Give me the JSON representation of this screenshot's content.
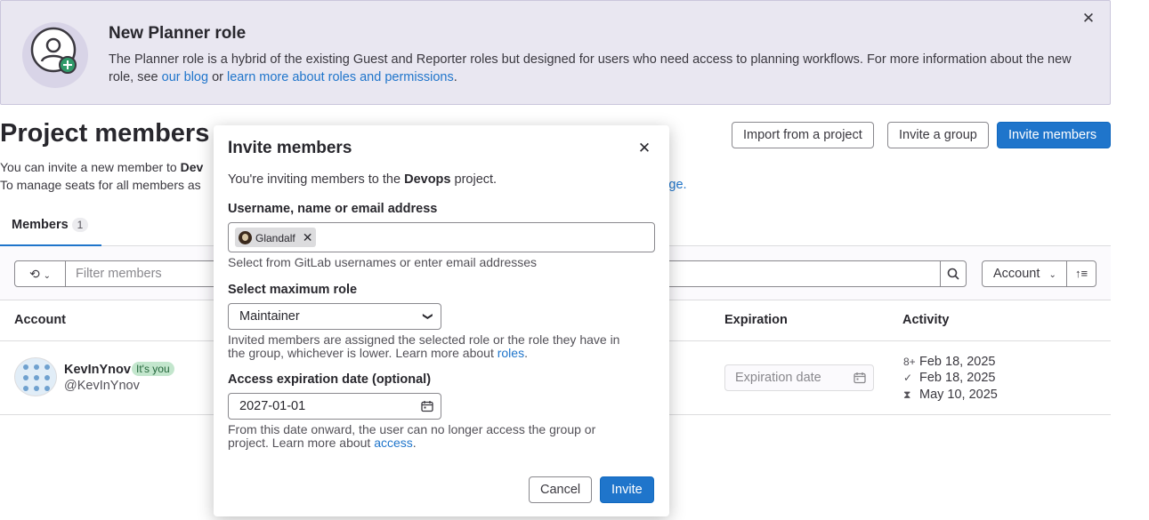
{
  "banner": {
    "title": "New Planner role",
    "body_text": "The Planner role is a hybrid of the existing Guest and Reporter roles but designed for users who need access to planning workflows. For more information about the new role, see ",
    "link_blog": "our blog",
    "or_text": " or ",
    "link_roles": "learn more about roles and permissions",
    "end_text": ".",
    "close_icon": "close-icon"
  },
  "page": {
    "title": "Project members",
    "desc_line1_prefix": "You can invite a new member to ",
    "desc_line1_bold": "Dev",
    "desc_line2": "To manage seats for all members as",
    "desc_line2_link": "s page."
  },
  "header_buttons": {
    "import": "Import from a project",
    "invite_group": "Invite a group",
    "invite_members": "Invite members"
  },
  "tabs": [
    {
      "label": "Members",
      "count": "1"
    }
  ],
  "filter": {
    "placeholder": "Filter members",
    "sort_label": "Account",
    "sort_dir_glyph": "↑≡"
  },
  "table": {
    "headers": {
      "account": "Account",
      "expiration": "Expiration",
      "activity": "Activity"
    },
    "rows": [
      {
        "name": "KevInYnov",
        "badge": "It's you",
        "username": "@KevInYnov",
        "expiration_placeholder": "Expiration date",
        "activity": [
          {
            "icon": "user-add-icon",
            "glyph": "8+",
            "date": "Feb 18, 2025"
          },
          {
            "icon": "check-icon",
            "glyph": "✓",
            "date": "Feb 18, 2025"
          },
          {
            "icon": "hourglass-icon",
            "glyph": "⧗",
            "date": "May 10, 2025"
          }
        ]
      }
    ]
  },
  "modal": {
    "title": "Invite members",
    "intro_prefix": "You're inviting members to the ",
    "intro_project": "Devops",
    "intro_suffix": " project.",
    "username_label": "Username, name or email address",
    "token_user": "Glandalf",
    "username_help": "Select from GitLab usernames or enter email addresses",
    "role_label": "Select maximum role",
    "role_value": "Maintainer",
    "role_help_line1": "Invited members are assigned the selected role or the role they have in",
    "role_help_line2": "the group, whichever is lower. Learn more about ",
    "role_help_link": "roles",
    "role_help_end": ".",
    "expiry_label": "Access expiration date (optional)",
    "expiry_value": "2027-01-01",
    "expiry_help_line1": "From this date onward, the user can no longer access the group or",
    "expiry_help_line2": "project. Learn more about ",
    "expiry_help_link": "access",
    "expiry_help_end": ".",
    "cancel": "Cancel",
    "invite": "Invite"
  },
  "colors": {
    "primary": "#1f75cb",
    "banner_bg": "#e9e7f1",
    "badge_bg": "#c3e6cd",
    "badge_text": "#24663b"
  }
}
